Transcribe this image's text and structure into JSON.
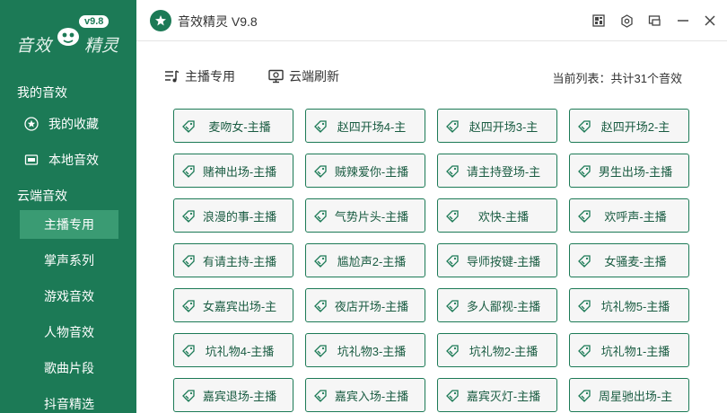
{
  "app": {
    "logo_text_left": "音效",
    "logo_text_right": "精灵",
    "version_badge": "v9.8",
    "window_title": "音效精灵 V9.8"
  },
  "sidebar": {
    "my_section": "我的音效",
    "my_items": [
      {
        "label": "我的收藏",
        "icon": "star-circle-icon"
      },
      {
        "label": "本地音效",
        "icon": "folder-icon"
      }
    ],
    "cloud_section": "云端音效",
    "cloud_items": [
      {
        "label": "主播专用",
        "active": true
      },
      {
        "label": "掌声系列",
        "active": false
      },
      {
        "label": "游戏音效",
        "active": false
      },
      {
        "label": "人物音效",
        "active": false
      },
      {
        "label": "歌曲片段",
        "active": false
      },
      {
        "label": "抖音精选",
        "active": false
      }
    ]
  },
  "toolbar": {
    "playlist_label": "主播专用",
    "refresh_label": "云端刷新",
    "list_count": "当前列表：共计31个音效"
  },
  "window_controls": [
    "skin-icon",
    "settings-hex-icon",
    "minimize-to-tray-icon",
    "minimize-icon",
    "close-icon"
  ],
  "sound_buttons": [
    "麦吻女-主播",
    "赵四开场4-主",
    "赵四开场3-主",
    "赵四开场2-主",
    "赌神出场-主播",
    "贼辣爱你-主播",
    "请主持登场-主",
    "男生出场-主播",
    "浪漫的事-主播",
    "气势片头-主播",
    "欢快-主播",
    "欢呼声-主播",
    "有请主持-主播",
    "尴尬声2-主播",
    "导师按键-主播",
    "女骚麦-主播",
    "女嘉宾出场-主",
    "夜店开场-主播",
    "多人鄙视-主播",
    "坑礼物5-主播",
    "坑礼物4-主播",
    "坑礼物3-主播",
    "坑礼物2-主播",
    "坑礼物1-主播",
    "嘉宾退场-主播",
    "嘉宾入场-主播",
    "嘉宾灭灯-主播",
    "周星驰出场-主"
  ],
  "colors": {
    "sidebar_bg": "#1c7a56",
    "sidebar_active": "#3a9b73",
    "button_border": "#1c7a56",
    "button_bg": "#f6f6f6"
  }
}
